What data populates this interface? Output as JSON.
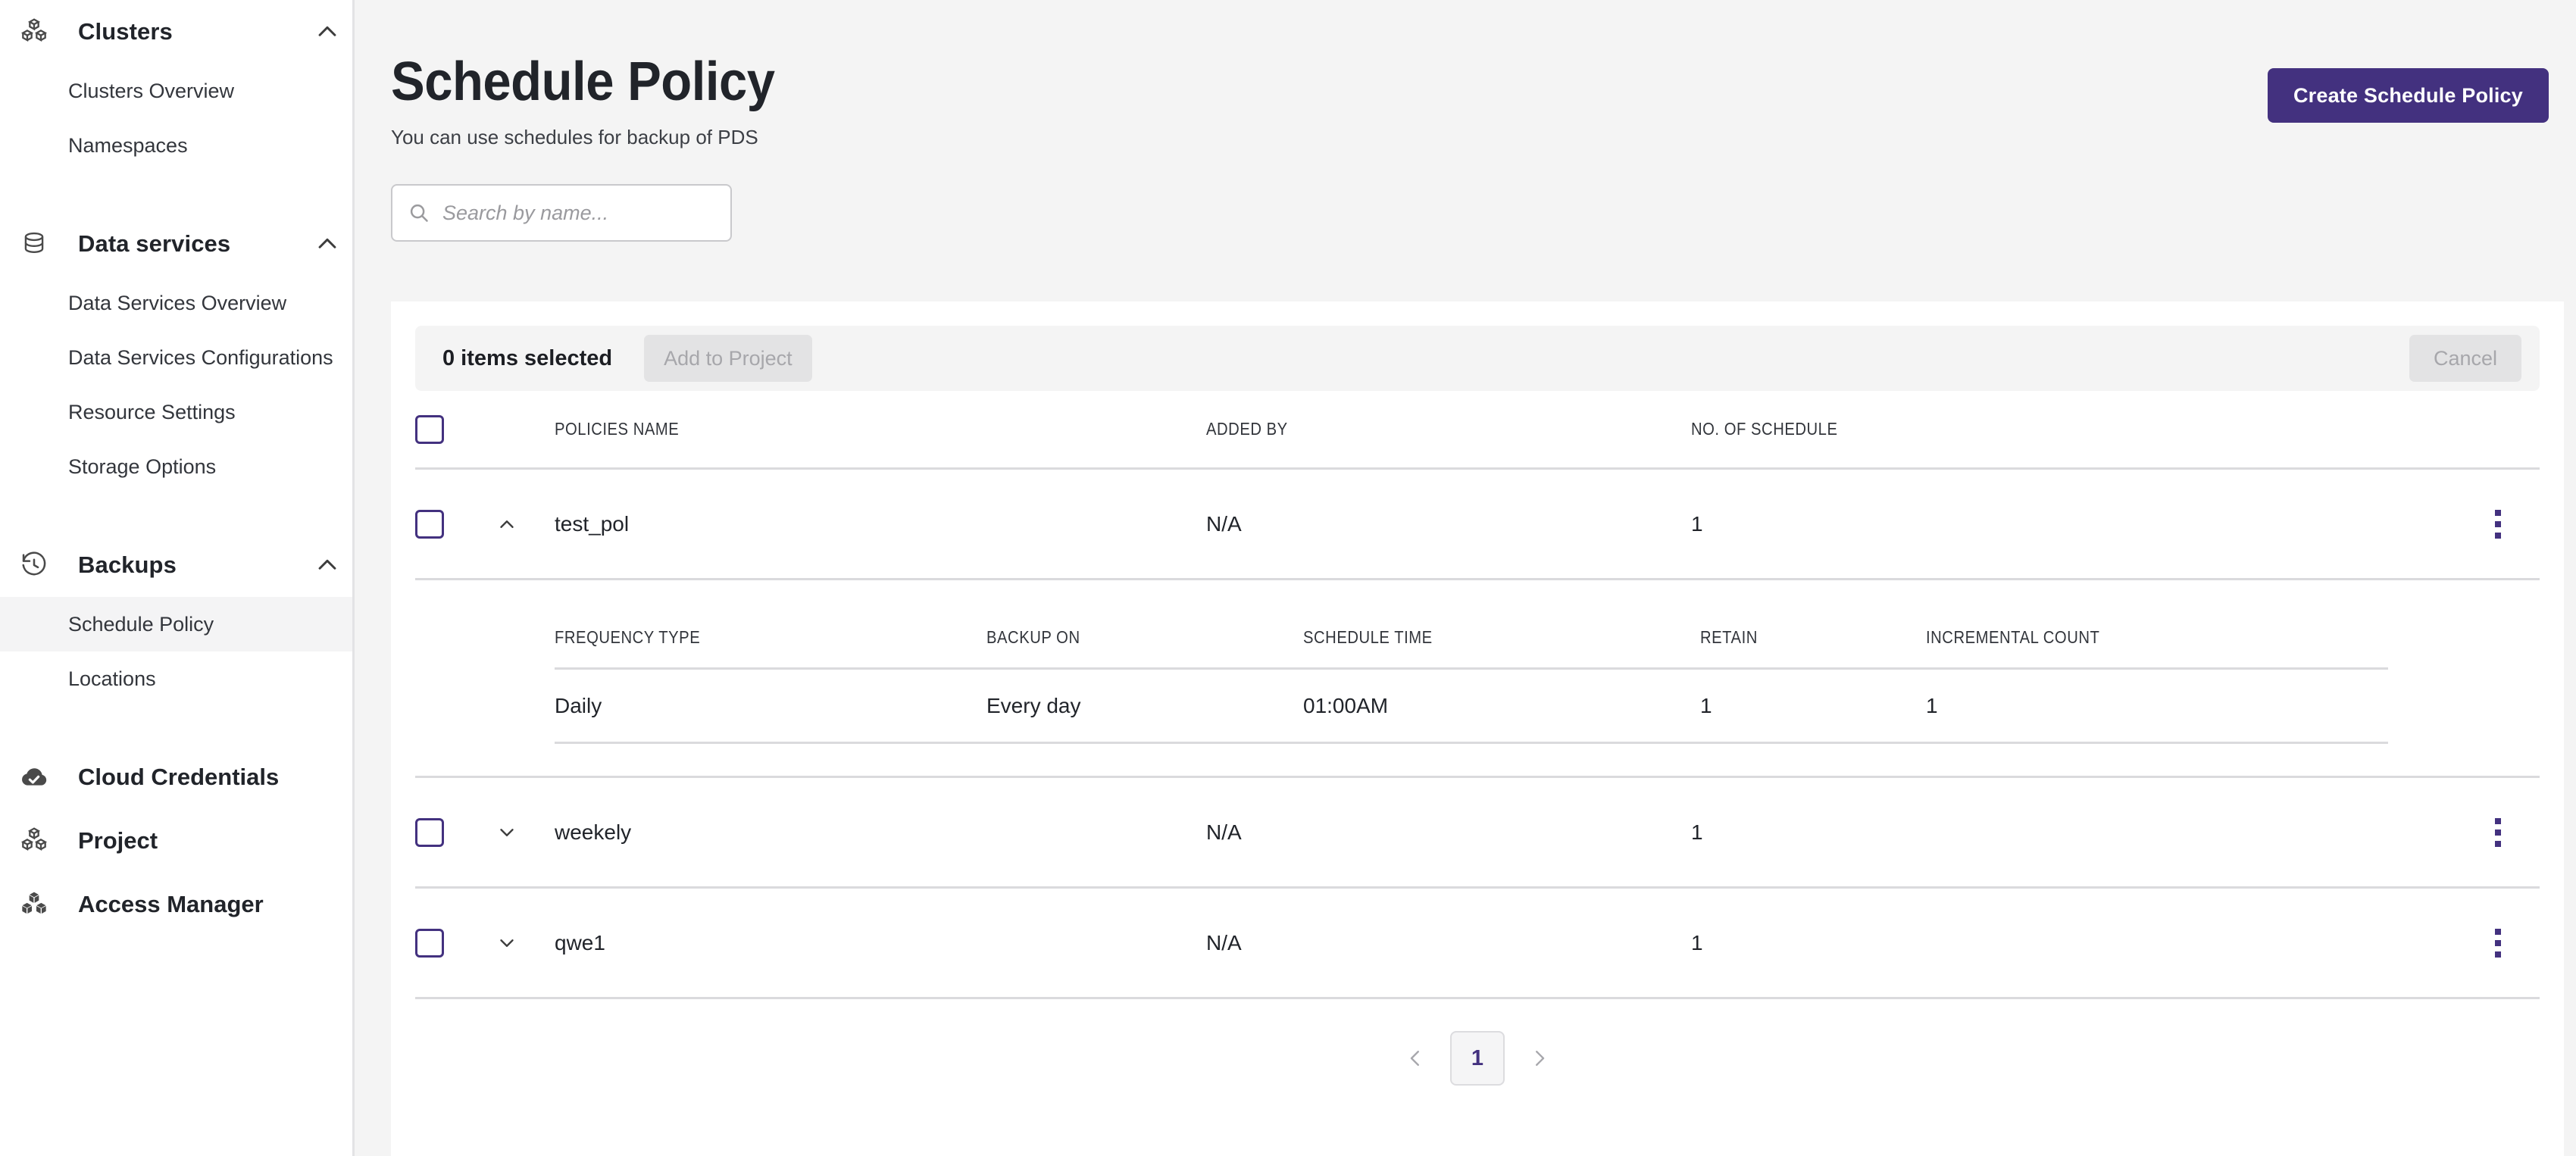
{
  "theme": {
    "accent": "#43317f",
    "page_bg": "#f4f4f4",
    "card_bg": "#ffffff",
    "border": "#dadadd",
    "muted_text": "#a7a7ab"
  },
  "sidebar": {
    "groups": [
      {
        "label": "Clusters",
        "icon": "cubes-icon",
        "expanded": true,
        "items": [
          {
            "label": "Clusters Overview",
            "active": false
          },
          {
            "label": "Namespaces",
            "active": false
          }
        ]
      },
      {
        "label": "Data services",
        "icon": "database-icon",
        "expanded": true,
        "items": [
          {
            "label": "Data Services Overview",
            "active": false
          },
          {
            "label": "Data Services Configurations",
            "active": false
          },
          {
            "label": "Resource Settings",
            "active": false
          },
          {
            "label": "Storage Options",
            "active": false
          }
        ]
      },
      {
        "label": "Backups",
        "icon": "history-clock-icon",
        "expanded": true,
        "items": [
          {
            "label": "Schedule Policy",
            "active": true
          },
          {
            "label": "Locations",
            "active": false
          }
        ]
      }
    ],
    "flat_items": [
      {
        "label": "Cloud Credentials",
        "icon": "cloud-check-icon"
      },
      {
        "label": "Project",
        "icon": "cubes-icon"
      },
      {
        "label": "Access Manager",
        "icon": "cubes-solid-icon"
      }
    ]
  },
  "header": {
    "title": "Schedule Policy",
    "subtitle": "You can use schedules for backup of PDS",
    "create_button": "Create Schedule Policy"
  },
  "search": {
    "value": "",
    "placeholder": "Search by name..."
  },
  "toolbar": {
    "selection_text": "0 items selected",
    "add_to_project": "Add to Project",
    "cancel": "Cancel"
  },
  "table": {
    "columns": [
      "POLICIES NAME",
      "ADDED BY",
      "NO. OF SCHEDULE"
    ],
    "rows": [
      {
        "name": "test_pol",
        "added_by": "N/A",
        "no_of_schedule": "1",
        "expanded": true
      },
      {
        "name": "weekely",
        "added_by": "N/A",
        "no_of_schedule": "1",
        "expanded": false
      },
      {
        "name": "qwe1",
        "added_by": "N/A",
        "no_of_schedule": "1",
        "expanded": false
      }
    ]
  },
  "sub_table": {
    "columns": [
      "FREQUENCY TYPE",
      "BACKUP ON",
      "SCHEDULE TIME",
      "RETAIN",
      "INCREMENTAL COUNT"
    ],
    "rows": [
      {
        "frequency_type": "Daily",
        "backup_on": "Every day",
        "schedule_time": "01:00AM",
        "retain": "1",
        "incremental_count": "1"
      }
    ]
  },
  "pagination": {
    "prev": "‹",
    "current_page": "1",
    "next": "›"
  }
}
